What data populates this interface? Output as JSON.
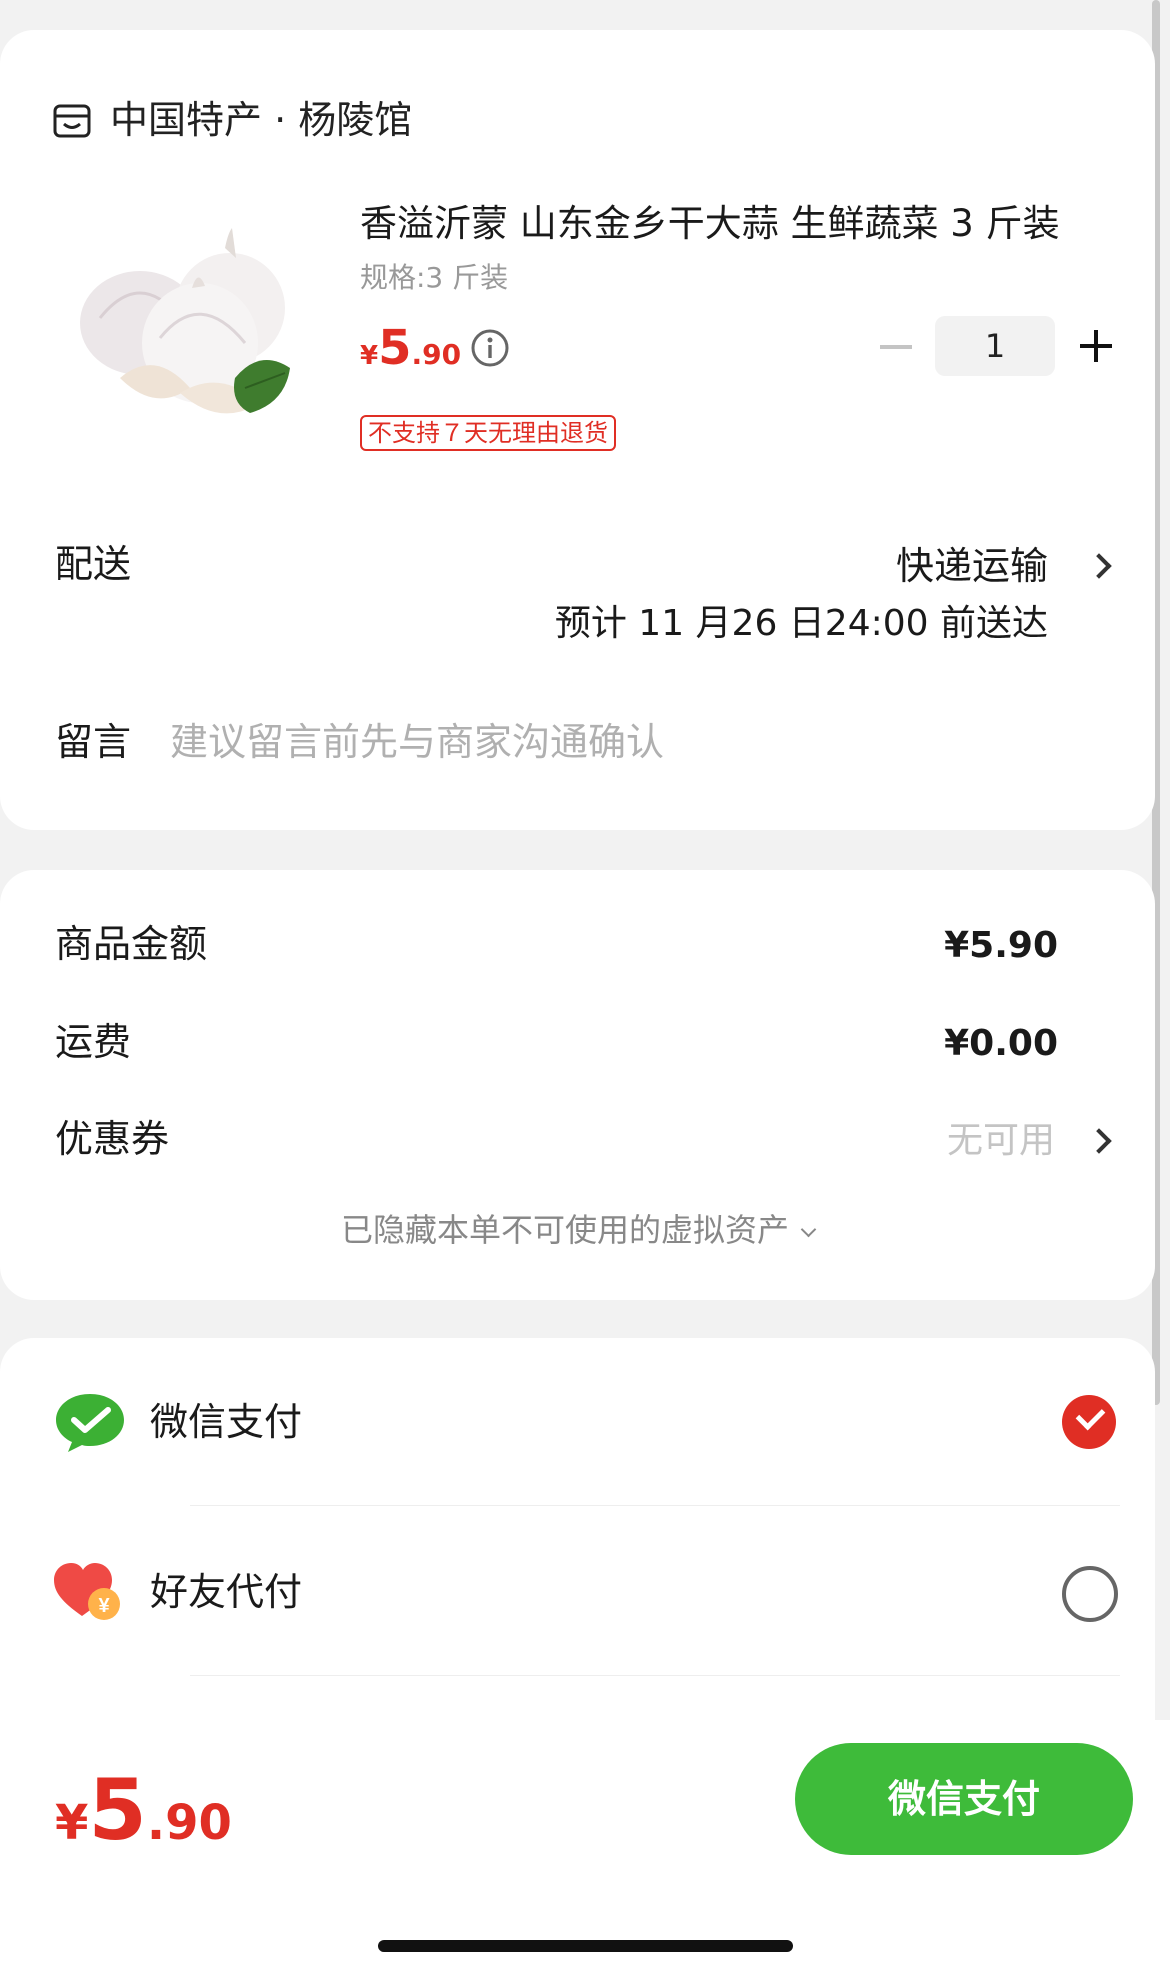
{
  "shop": {
    "name": "中国特产 · 杨陵馆",
    "icon": "storefront-icon"
  },
  "product": {
    "title": "香溢沂蒙 山东金乡干大蒜 生鲜蔬菜 3 斤装",
    "spec": "规格:3 斤装",
    "price": {
      "currency": "¥",
      "integer": "5",
      "decimal": ".90"
    },
    "quantity": "1",
    "return_policy": "不支持７天无理由退货"
  },
  "delivery": {
    "label": "配送",
    "method": "快递运输",
    "eta": "预计 11 月26 日24:00 前送达"
  },
  "note": {
    "label": "留言",
    "placeholder": "建议留言前先与商家沟通确认"
  },
  "summary": {
    "subtotal_label": "商品金额",
    "subtotal_value": "¥5.90",
    "shipping_label": "运费",
    "shipping_value": "¥0.00",
    "coupon_label": "优惠券",
    "coupon_value": "无可用",
    "hidden_assets": "已隐藏本单不可使用的虚拟资产"
  },
  "payment": {
    "options": [
      {
        "label": "微信支付",
        "icon": "wechat-pay-icon",
        "selected": true
      },
      {
        "label": "好友代付",
        "icon": "friend-pay-icon",
        "selected": false
      }
    ]
  },
  "footer": {
    "total": {
      "currency": "¥",
      "integer": "5",
      "decimal": ".90"
    },
    "pay_button": "微信支付"
  },
  "colors": {
    "accent": "#e02e24",
    "pay_green": "#3ebb3a"
  }
}
